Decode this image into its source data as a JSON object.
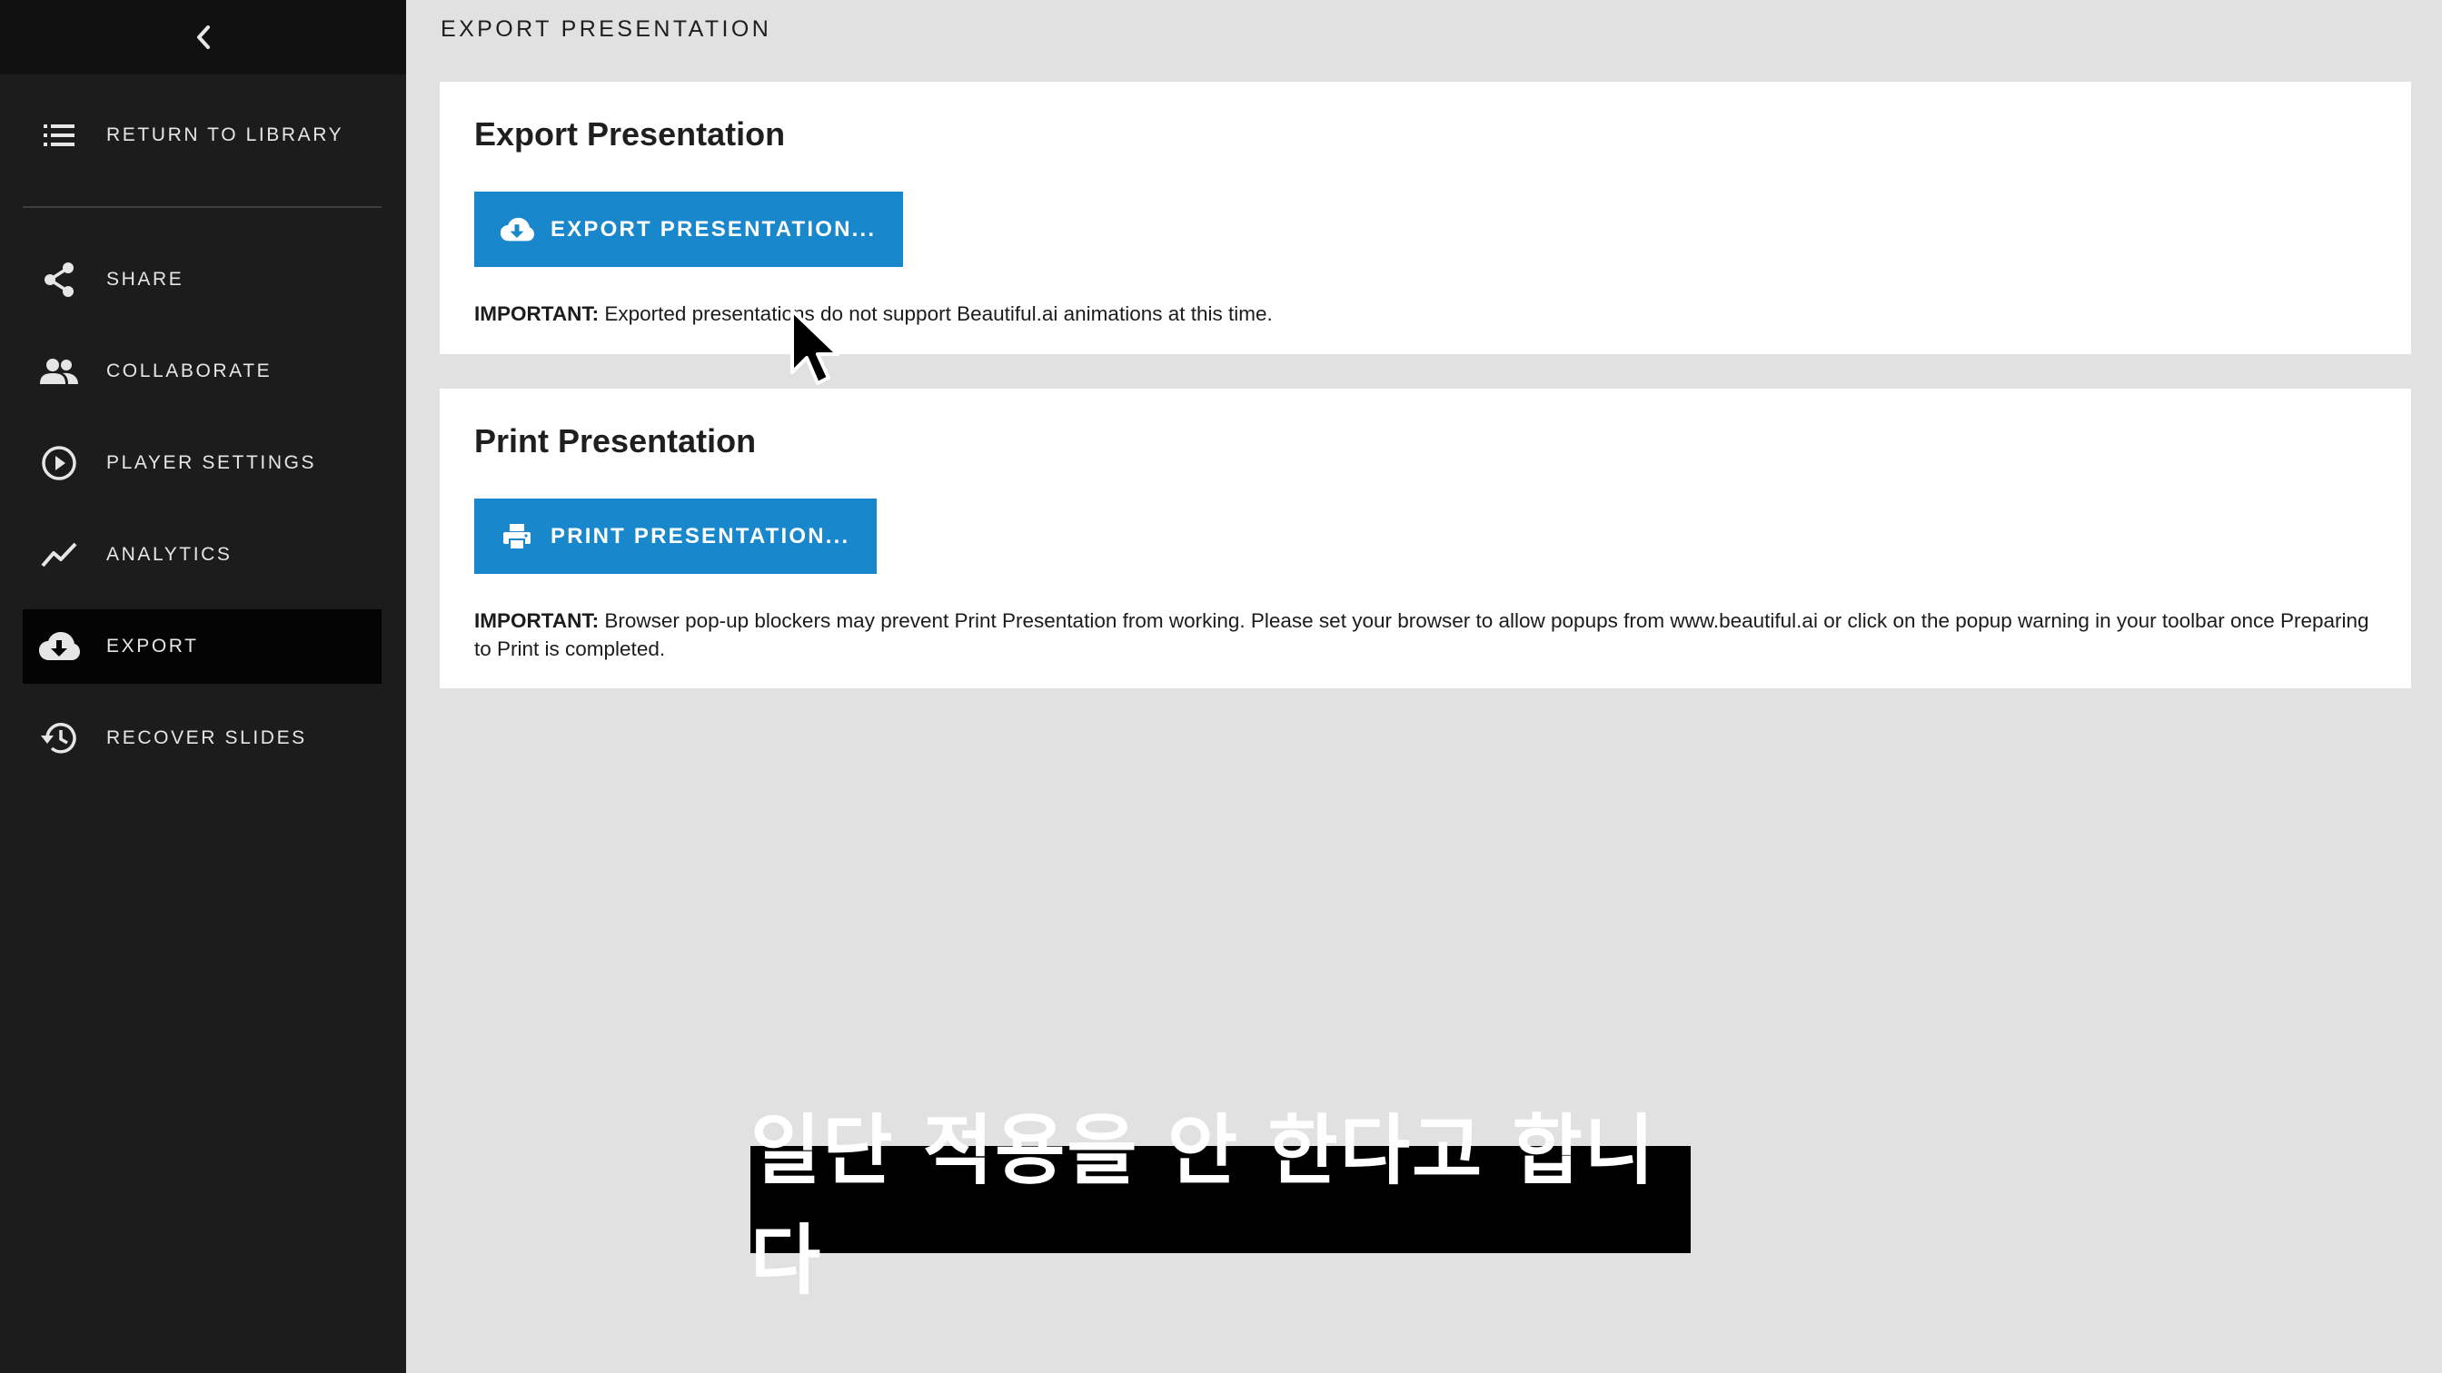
{
  "sidebar": {
    "back_icon": "chevron-left-icon",
    "return_label": "RETURN TO LIBRARY",
    "items": [
      {
        "label": "SHARE",
        "icon": "share-icon"
      },
      {
        "label": "COLLABORATE",
        "icon": "people-icon"
      },
      {
        "label": "PLAYER SETTINGS",
        "icon": "play-circle-icon"
      },
      {
        "label": "ANALYTICS",
        "icon": "trend-line-icon"
      },
      {
        "label": "EXPORT",
        "icon": "cloud-download-icon",
        "active": true
      },
      {
        "label": "RECOVER SLIDES",
        "icon": "history-icon"
      }
    ]
  },
  "main": {
    "heading": "EXPORT PRESENTATION",
    "export_card": {
      "title": "Export Presentation",
      "button_label": "EXPORT PRESENTATION...",
      "note_prefix": "IMPORTANT:",
      "note_text": " Exported presentations do not support Beautiful.ai animations at this time."
    },
    "print_card": {
      "title": "Print Presentation",
      "button_label": "PRINT PRESENTATION...",
      "note_prefix": "IMPORTANT:",
      "note_text": " Browser pop-up blockers may prevent Print Presentation from working. Please set your browser to allow popups from www.beautiful.ai or click on the popup warning in your toolbar once Preparing to Print is completed."
    }
  },
  "subtitle": "일단 적용을 안 한다고 합니다",
  "colors": {
    "sidebar_bg": "#1c1c1c",
    "active_bg": "#040404",
    "accent_blue": "#1887cc",
    "page_bg": "#e1e1e1"
  }
}
